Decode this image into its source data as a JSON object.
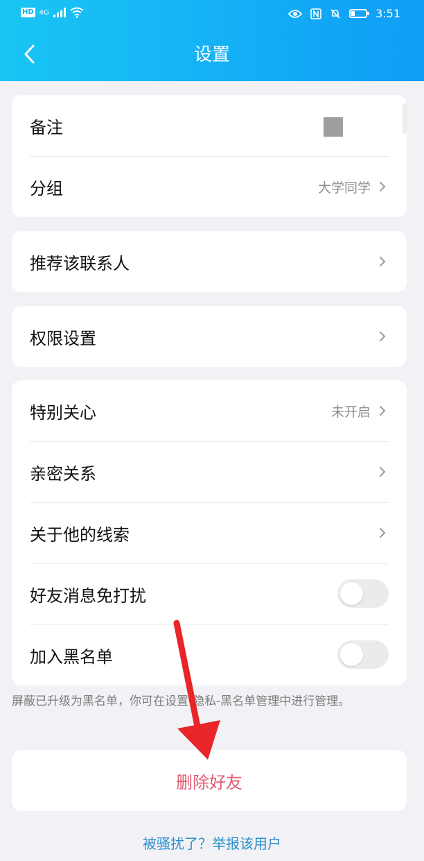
{
  "status_bar": {
    "hd": "HD",
    "network": "4G",
    "time": "3:51"
  },
  "header": {
    "title": "设置",
    "back_icon": "chevron-left-icon"
  },
  "card1": {
    "remark_label": "备注",
    "group_label": "分组",
    "group_value": "大学同学"
  },
  "card2": {
    "recommend_label": "推荐该联系人"
  },
  "card3": {
    "permission_label": "权限设置"
  },
  "card4": {
    "special_care_label": "特别关心",
    "special_care_value": "未开启",
    "intimacy_label": "亲密关系",
    "clues_label": "关于他的线索",
    "mute_label": "好友消息免打扰",
    "blacklist_label": "加入黑名单"
  },
  "note_text": "屏蔽已升级为黑名单，你可在设置-隐私-黑名单管理中进行管理。",
  "delete_label": "删除好友",
  "report_label": "被骚扰了？举报该用户",
  "colors": {
    "header_start": "#19c6f4",
    "header_end": "#0f9df6",
    "delete_text": "#df5d74",
    "report_text": "#2a8fcd",
    "annotation_arrow": "#e8262a"
  }
}
